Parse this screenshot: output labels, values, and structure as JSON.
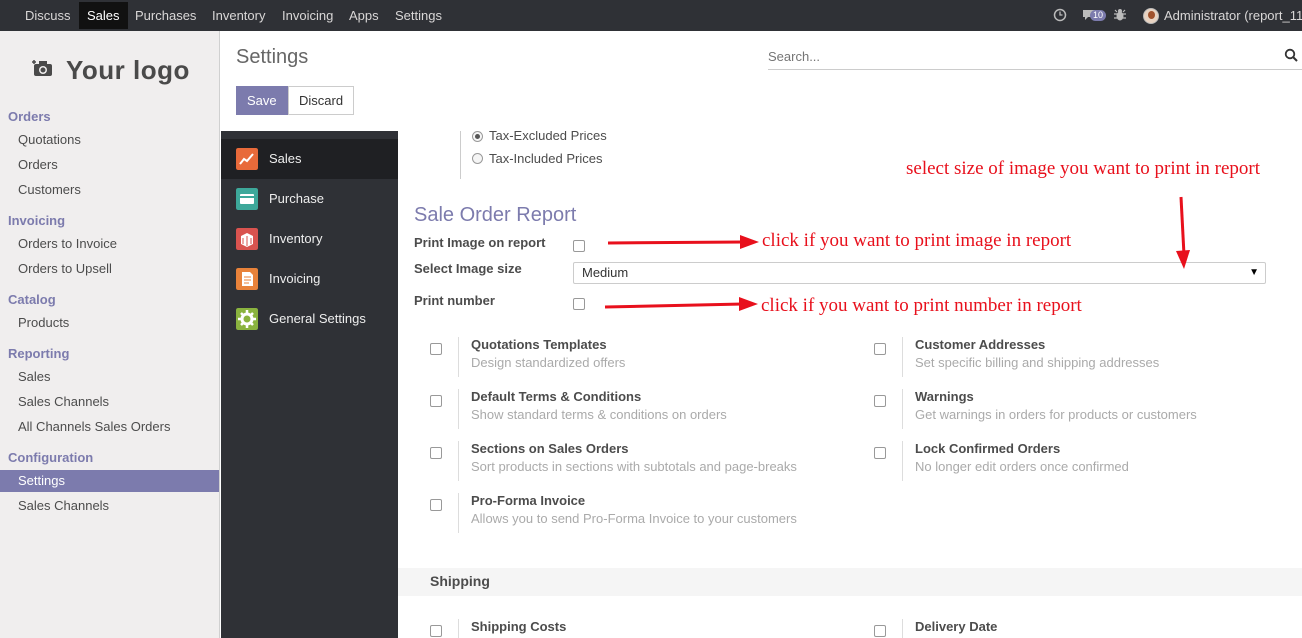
{
  "navbar": {
    "items": [
      "Discuss",
      "Sales",
      "Purchases",
      "Inventory",
      "Invoicing",
      "Apps",
      "Settings"
    ],
    "active": "Sales",
    "messages_count": "10",
    "user": "Administrator (report_11"
  },
  "sidebar": {
    "logo_text": "Your logo",
    "sections": [
      {
        "title": "Orders",
        "items": [
          "Quotations",
          "Orders",
          "Customers"
        ]
      },
      {
        "title": "Invoicing",
        "items": [
          "Orders to Invoice",
          "Orders to Upsell"
        ]
      },
      {
        "title": "Catalog",
        "items": [
          "Products"
        ]
      },
      {
        "title": "Reporting",
        "items": [
          "Sales",
          "Sales Channels",
          "All Channels Sales Orders"
        ]
      },
      {
        "title": "Configuration",
        "items": [
          "Settings",
          "Sales Channels"
        ]
      }
    ],
    "active_item": "Settings"
  },
  "control_panel": {
    "title": "Settings",
    "search_placeholder": "Search...",
    "save_label": "Save",
    "discard_label": "Discard"
  },
  "settings_nav": {
    "items": [
      {
        "label": "Sales",
        "icon": "sales-chart-icon",
        "color": "#e86a3a"
      },
      {
        "label": "Purchase",
        "icon": "purchase-card-icon",
        "color": "#3da89a"
      },
      {
        "label": "Inventory",
        "icon": "inventory-box-icon",
        "color": "#d9534f"
      },
      {
        "label": "Invoicing",
        "icon": "invoice-doc-icon",
        "color": "#e8823a"
      },
      {
        "label": "General Settings",
        "icon": "gear-icon",
        "color": "#8ab33f"
      }
    ],
    "active": "Sales"
  },
  "pricing": {
    "options": [
      "Tax-Excluded Prices",
      "Tax-Included Prices"
    ],
    "selected": "Tax-Excluded Prices"
  },
  "report": {
    "title": "Sale Order Report",
    "print_image_label": "Print Image on report",
    "image_size_label": "Select Image size",
    "image_size_value": "Medium",
    "print_number_label": "Print number"
  },
  "annotations": {
    "size_hint": "select size of image you want to print in report",
    "image_hint": "click if you want to print image in report",
    "number_hint": "click if you want to print number in report"
  },
  "options": [
    {
      "title": "Quotations Templates",
      "desc": "Design standardized offers"
    },
    {
      "title": "Customer Addresses",
      "desc": "Set specific billing and shipping addresses"
    },
    {
      "title": "Default Terms & Conditions",
      "desc": "Show standard terms & conditions on orders"
    },
    {
      "title": "Warnings",
      "desc": "Get warnings in orders for products or customers"
    },
    {
      "title": "Sections on Sales Orders",
      "desc": "Sort products in sections with subtotals and page-breaks"
    },
    {
      "title": "Lock Confirmed Orders",
      "desc": "No longer edit orders once confirmed"
    },
    {
      "title": "Pro-Forma Invoice",
      "desc": "Allows you to send Pro-Forma Invoice to your customers"
    }
  ],
  "shipping": {
    "title": "Shipping",
    "options": [
      "Shipping Costs",
      "Delivery Date"
    ]
  }
}
